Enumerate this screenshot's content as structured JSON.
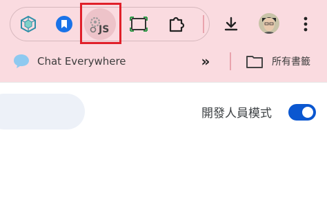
{
  "extensions": {
    "items": [
      {
        "name": "network-extension",
        "icon": "hexagon-network-icon"
      },
      {
        "name": "bookmark-extension",
        "icon": "bookmark-icon"
      },
      {
        "name": "js-extension",
        "icon": "js-gear-icon",
        "label": "JS"
      },
      {
        "name": "screenshot-extension",
        "icon": "screen-capture-icon"
      },
      {
        "name": "extensions-menu",
        "icon": "puzzle-icon"
      }
    ]
  },
  "toolbar": {
    "download_icon": "download-icon",
    "profile_icon": "avatar",
    "menu_icon": "more-vert-icon"
  },
  "bookmarks": {
    "chat_label": "Chat Everywhere",
    "more_label": "»",
    "all_bookmarks_label": "所有書籤"
  },
  "page": {
    "developer_mode_label": "開發人員模式",
    "developer_mode_on": true
  },
  "colors": {
    "toolbar_bg": "#fadbe0",
    "accent": "#0b57d0",
    "highlight": "#e0202a"
  }
}
